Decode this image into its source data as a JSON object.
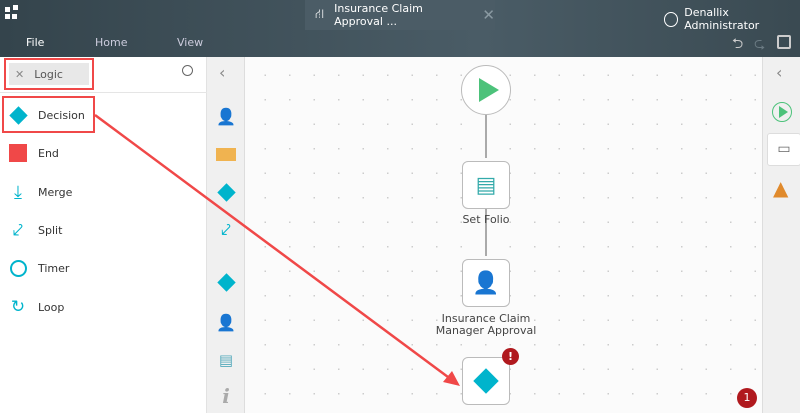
{
  "app": {
    "tab_title": "Insurance Claim Approval ...",
    "user": "Denallix Administrator"
  },
  "menu": {
    "file": "File",
    "home": "Home",
    "view": "View"
  },
  "toolbox": {
    "breadcrumb": "Logic",
    "items": [
      {
        "label": "Decision"
      },
      {
        "label": "End"
      },
      {
        "label": "Merge"
      },
      {
        "label": "Split"
      },
      {
        "label": "Timer"
      },
      {
        "label": "Loop"
      }
    ]
  },
  "canvas": {
    "nodes": [
      {
        "label": "Set Folio"
      },
      {
        "label": "Insurance Claim"
      },
      {
        "label": "Manager Approval"
      }
    ],
    "error_badge": "!",
    "error_count": "1"
  },
  "colors": {
    "accent": "#00b4cc",
    "annotation": "#f04848",
    "start": "#4cc27a",
    "error": "#b0191e",
    "warning": "#e08a2c"
  }
}
